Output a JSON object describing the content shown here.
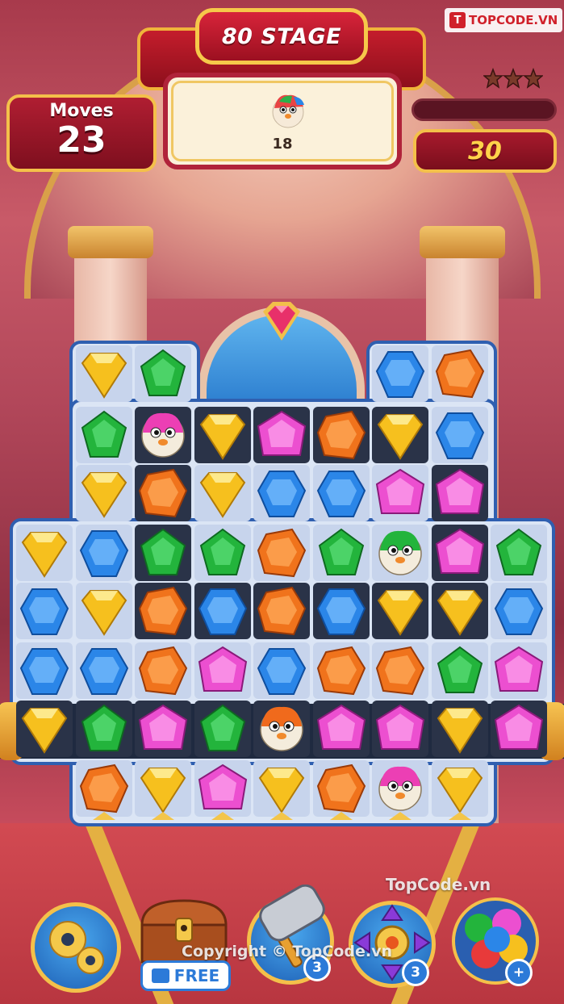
{
  "brand": {
    "label": "TOPCODE.VN",
    "logo": "T"
  },
  "stage": {
    "title": "80 STAGE"
  },
  "goal": {
    "icon": "rainbow-pufferfish-icon",
    "count": "18"
  },
  "moves": {
    "label": "Moves",
    "value": "23"
  },
  "stars": {
    "icon": "three-stars-icon",
    "earned": 0,
    "total": 3
  },
  "progress": {
    "fraction": 0.0
  },
  "score": {
    "value": "30"
  },
  "pieces": {
    "colors": {
      "yellow": "#f6c01e",
      "green": "#23b43c",
      "blue": "#2b86e8",
      "orange": "#f0731c",
      "pink": "#ec4fd0"
    },
    "rows": [
      [
        "yellow",
        "green",
        null,
        null,
        null,
        null,
        "blue",
        "orange"
      ],
      [
        "green",
        "puffer-pink",
        "yellow",
        "pink",
        "orange",
        "yellow",
        "blue",
        null
      ],
      [
        "yellow",
        "orange",
        "yellow",
        "blue",
        "blue",
        "pink",
        "pink",
        null
      ],
      [
        "yellow",
        "blue",
        "green",
        "green",
        "orange",
        "green",
        "puffer-green",
        "pink",
        "green"
      ],
      [
        "blue",
        "yellow",
        "orange",
        "blue",
        "orange",
        "blue",
        "yellow",
        "yellow",
        "blue"
      ],
      [
        "blue",
        "blue",
        "orange",
        "pink",
        "blue",
        "orange",
        "orange",
        "green",
        "pink"
      ],
      [
        "yellow",
        "green",
        "pink",
        "green",
        "puffer-orange",
        "pink",
        "pink",
        "yellow",
        "pink"
      ],
      [
        "orange",
        "yellow",
        "pink",
        "yellow",
        "orange",
        "puffer-pink",
        "yellow"
      ]
    ]
  },
  "boosters": [
    {
      "name": "settings",
      "icon": "gears-icon"
    },
    {
      "name": "treasure-chest",
      "icon": "chest-icon",
      "tag": "FREE",
      "tag_icon": "clapperboard-icon"
    },
    {
      "name": "hammer",
      "icon": "hammer-icon",
      "count": "3"
    },
    {
      "name": "cross-blast",
      "icon": "cross-arrows-icon",
      "count": "3"
    },
    {
      "name": "color-balls",
      "icon": "color-balls-icon",
      "count": "+"
    }
  ],
  "watermarks": {
    "top": "TopCode.vn",
    "bottom": "Copyright © TopCode.vn"
  }
}
